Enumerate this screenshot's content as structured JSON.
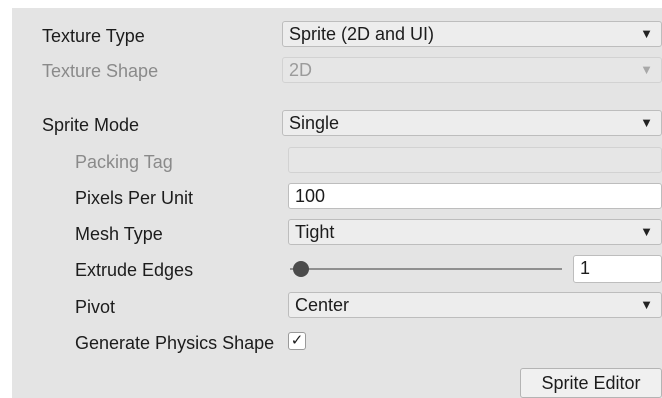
{
  "inspector": {
    "texture_type": {
      "label": "Texture Type",
      "value": "Sprite (2D and UI)",
      "icon": "chevron-down-icon"
    },
    "texture_shape": {
      "label": "Texture Shape",
      "value": "2D",
      "icon": "chevron-down-icon",
      "disabled": true
    },
    "sprite_mode": {
      "label": "Sprite Mode",
      "value": "Single",
      "icon": "chevron-down-icon"
    },
    "packing_tag": {
      "label": "Packing Tag",
      "value": "",
      "disabled": true
    },
    "pixels_per_unit": {
      "label": "Pixels Per Unit",
      "value": "100"
    },
    "mesh_type": {
      "label": "Mesh Type",
      "value": "Tight",
      "icon": "chevron-down-icon"
    },
    "extrude_edges": {
      "label": "Extrude Edges",
      "value": "1",
      "min": 0,
      "max": 32
    },
    "pivot": {
      "label": "Pivot",
      "value": "Center",
      "icon": "chevron-down-icon"
    },
    "generate_physics_shape": {
      "label": "Generate Physics Shape",
      "checked": true,
      "check_glyph": "✓"
    },
    "sprite_editor_button": "Sprite Editor"
  },
  "colors": {
    "panel_bg": "#e4e4e4",
    "field_bg": "#ededed",
    "text": "#1c1c1c",
    "disabled_text": "#8a8a8a"
  }
}
